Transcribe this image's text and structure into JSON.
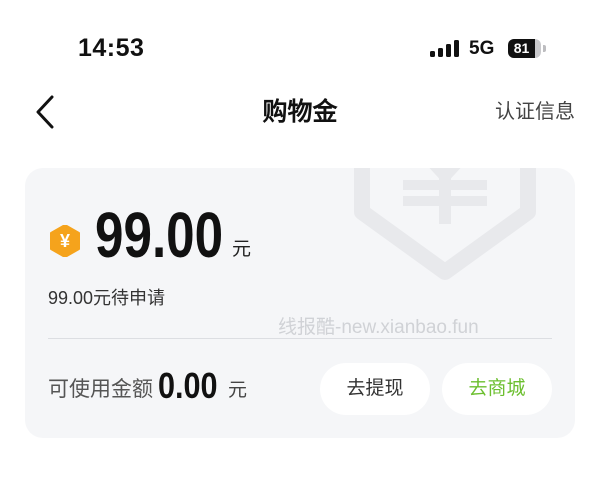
{
  "status_bar": {
    "time": "14:53",
    "network": "5G",
    "battery": "81",
    "signal_icon": "cellular-signal-icon",
    "battery_icon": "battery-icon"
  },
  "nav": {
    "back_icon": "chevron-left-icon",
    "title": "购物金",
    "right_link": "认证信息"
  },
  "card": {
    "watermark_icon": "yen-hexagon-icon",
    "coin_symbol": "¥",
    "amount": "99.00",
    "amount_unit": "元",
    "pending_text": "99.00元待申请",
    "watermark_text": "线报酷-new.xianbao.fun",
    "available_label": "可使用金额",
    "available_amount": "0.00",
    "available_unit": "元",
    "withdraw_button": "去提现",
    "shop_button": "去商城"
  },
  "colors": {
    "accent_green": "#6cbf2f",
    "coin_orange": "#f5a31c",
    "card_bg": "#f5f6f8"
  }
}
